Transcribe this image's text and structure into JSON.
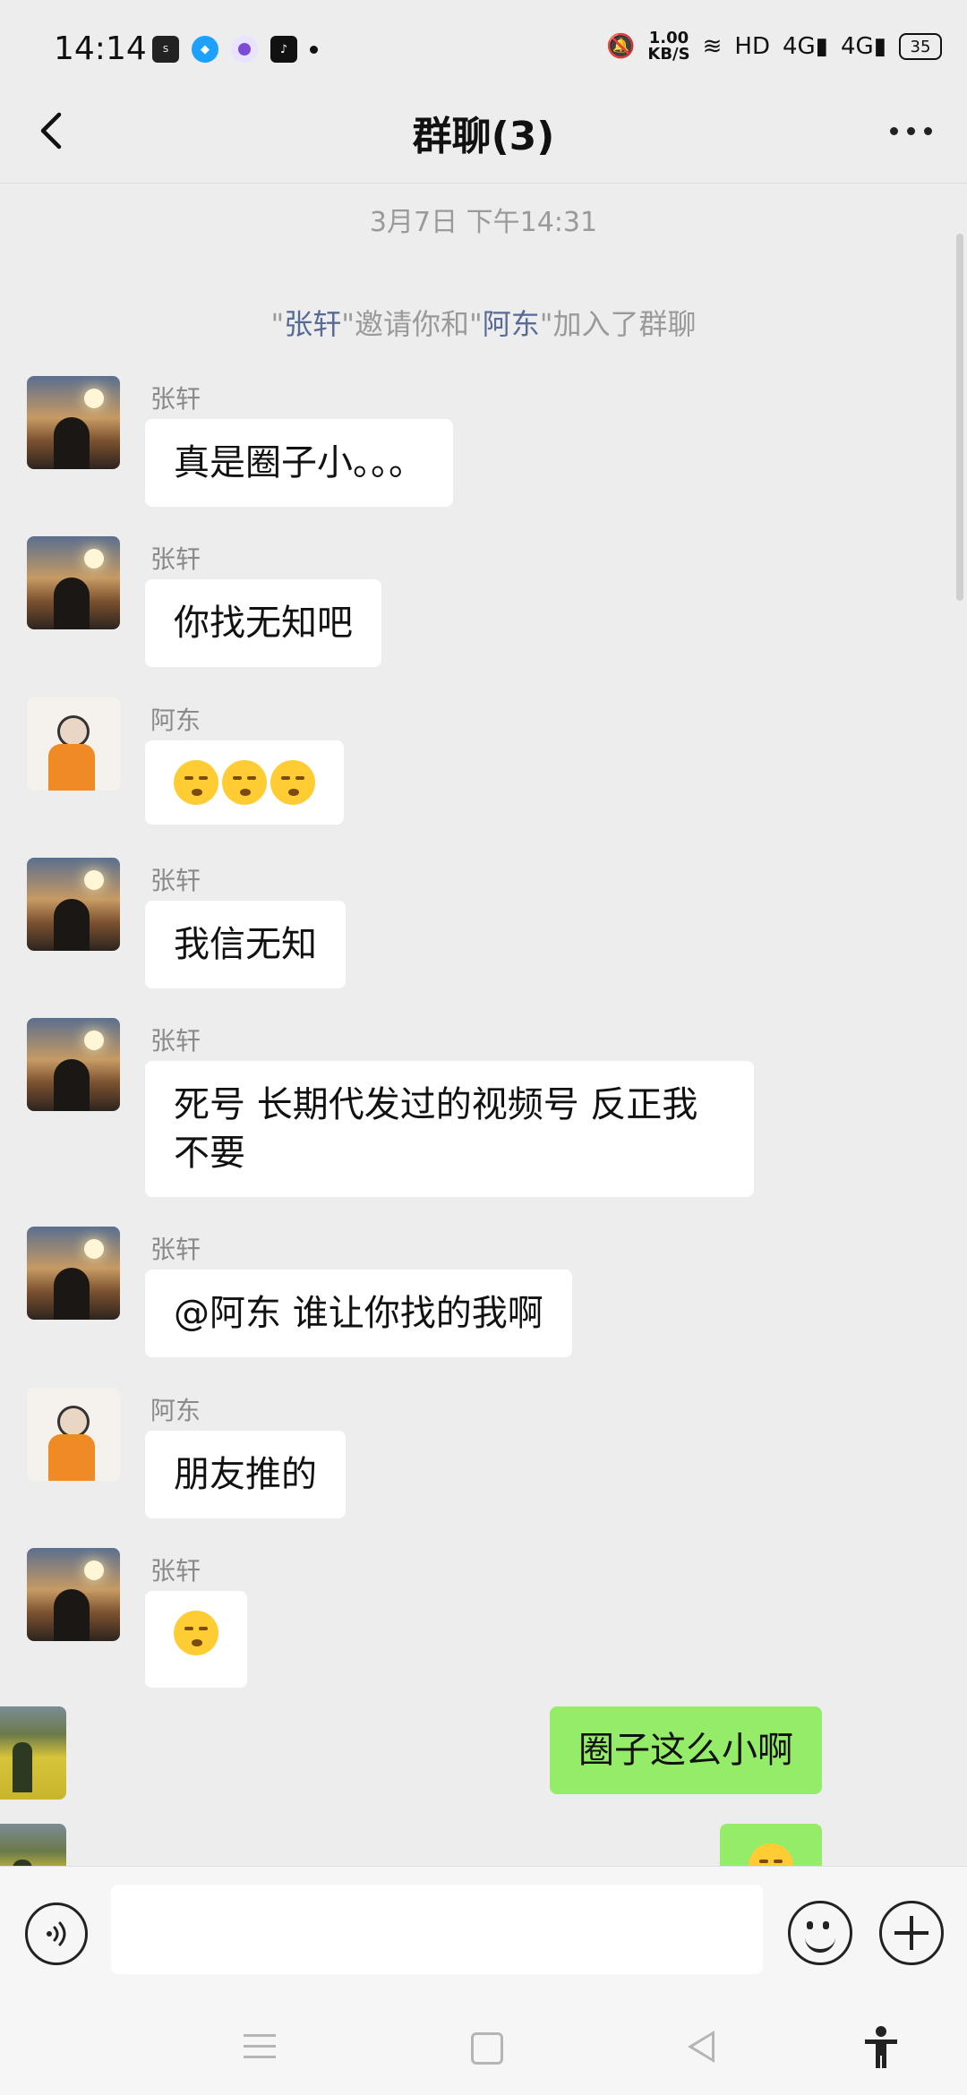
{
  "status_bar": {
    "time": "14:14",
    "net_speed_value": "1.00",
    "net_speed_unit": "KB/S",
    "hd": "HD",
    "signal_1": "4G",
    "signal_2": "4G",
    "battery": "35",
    "app_icons": [
      "soul-app-icon",
      "qq-icon",
      "purple-app-icon",
      "tiktok-icon"
    ]
  },
  "header": {
    "title": "群聊(3)",
    "back_icon": "chevron-left-icon",
    "more_icon": "more-dots-icon"
  },
  "chat": {
    "timestamp": "3月7日 下午14:31",
    "system_message": {
      "prefix": "\"",
      "inviter": "张轩",
      "mid": "\"邀请你和\"",
      "invitee": "阿东",
      "suffix": "\"加入了群聊"
    },
    "messages": [
      {
        "sender": "张轩",
        "text": "真是圈子小。。。"
      },
      {
        "sender": "张轩",
        "text": "你找无知吧"
      },
      {
        "sender": "阿东",
        "emoji": [
          "shushing-face-emoji",
          "shushing-face-emoji",
          "shushing-face-emoji"
        ]
      },
      {
        "sender": "张轩",
        "text": "我信无知"
      },
      {
        "sender": "张轩",
        "text": "死号 长期代发过的视频号 反正我不要"
      },
      {
        "sender": "张轩",
        "text": "@阿东 谁让你找的我啊"
      },
      {
        "sender": "阿东",
        "text": "朋友推的"
      },
      {
        "sender": "张轩",
        "emoji": [
          "thinking-face-emoji"
        ]
      },
      {
        "sender": "self",
        "text": "圈子这么小啊"
      },
      {
        "sender": "self",
        "emoji": [
          "smile-emoji"
        ]
      }
    ]
  },
  "input_bar": {
    "voice_icon": "voice-icon",
    "input_value": "",
    "emoji_icon": "emoji-icon",
    "plus_icon": "plus-icon"
  },
  "nav_bar": {
    "icons": [
      "menu-icon",
      "home-icon",
      "back-icon",
      "accessibility-icon"
    ]
  },
  "colors": {
    "background": "#ededed",
    "self_bubble": "#95ec69",
    "name_link": "#576b95"
  }
}
